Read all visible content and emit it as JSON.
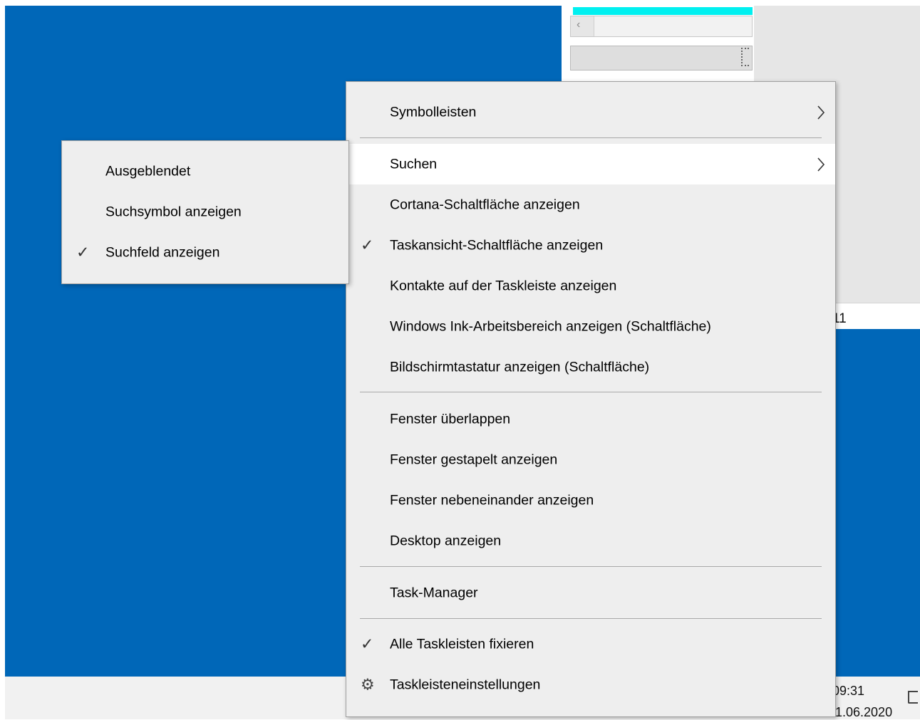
{
  "background_window": {
    "status_text": "11"
  },
  "clock": {
    "time": "09:31",
    "date": "1.06.2020"
  },
  "context_menu": {
    "items": [
      {
        "label": "Symbolleisten",
        "has_submenu": true
      },
      {
        "label": "Suchen",
        "has_submenu": true,
        "highlighted": true
      },
      {
        "label": "Cortana-Schaltfläche anzeigen"
      },
      {
        "label": "Taskansicht-Schaltfläche anzeigen",
        "checked": true
      },
      {
        "label": "Kontakte auf der Taskleiste anzeigen"
      },
      {
        "label": "Windows Ink-Arbeitsbereich anzeigen (Schaltfläche)"
      },
      {
        "label": "Bildschirmtastatur anzeigen (Schaltfläche)"
      },
      {
        "label": "Fenster überlappen"
      },
      {
        "label": "Fenster gestapelt anzeigen"
      },
      {
        "label": "Fenster nebeneinander anzeigen"
      },
      {
        "label": "Desktop anzeigen"
      },
      {
        "label": "Task-Manager"
      },
      {
        "label": "Alle Taskleisten fixieren",
        "checked": true
      },
      {
        "label": "Taskleisteneinstellungen",
        "icon": "gear-icon"
      }
    ]
  },
  "search_submenu": {
    "items": [
      {
        "label": "Ausgeblendet"
      },
      {
        "label": "Suchsymbol anzeigen"
      },
      {
        "label": "Suchfeld anzeigen",
        "checked": true
      }
    ]
  },
  "glyphs": {
    "check": "✓",
    "gear": "⚙",
    "scroll_left": "‹"
  },
  "colors": {
    "desktop": "#0067b8",
    "menu_bg": "#eeeeee",
    "menu_hover": "#ffffff",
    "taskbar": "#f1f1f1",
    "accent_cyan": "#00f0f0"
  }
}
